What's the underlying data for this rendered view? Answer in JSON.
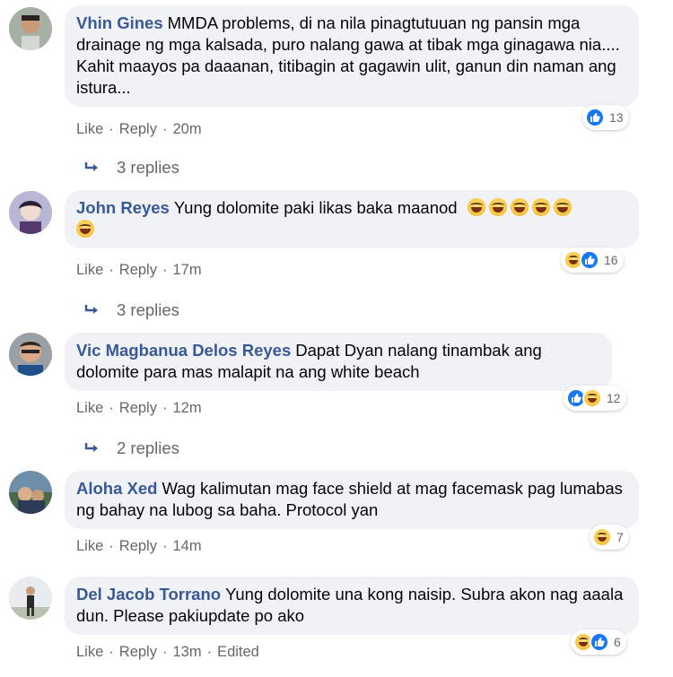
{
  "colors": {
    "author": "#385898",
    "bubble": "#f0f2f5",
    "meta": "#65676b",
    "like_blue": "#1877f2",
    "haha_yellow": "#f7c23a"
  },
  "actions": {
    "like": "Like",
    "reply": "Reply"
  },
  "comments": [
    {
      "author": "Vhin Gines",
      "text": "MMDA problems, di na nila pinagtutuuan ng pansin mga drainage ng mga kalsada, puro nalang gawa at tibak mga ginagawa nia.... Kahit maayos pa daaanan, titibagin at gagawin ulit, ganun din naman ang istura...",
      "time": "20m",
      "edited": "",
      "reactions": {
        "icons": [
          "like-icon"
        ],
        "count": "13"
      },
      "replies": "3 replies"
    },
    {
      "author": "John Reyes",
      "text": "Yung dolomite paki likas baka maanod",
      "emoji_count": 6,
      "time": "17m",
      "edited": "",
      "reactions": {
        "icons": [
          "haha-icon",
          "like-icon"
        ],
        "count": "16"
      },
      "replies": "3 replies"
    },
    {
      "author": "Vic Magbanua Delos Reyes",
      "text": "Dapat Dyan nalang tinambak ang dolomite para mas malapit na ang white beach",
      "time": "12m",
      "edited": "",
      "reactions": {
        "icons": [
          "like-icon",
          "haha-icon"
        ],
        "count": "12"
      },
      "replies": "2 replies"
    },
    {
      "author": "Aloha Xed",
      "text": "Wag kalimutan mag face shield at mag facemask pag lumabas ng bahay na lubog sa baha. Protocol yan",
      "time": "14m",
      "edited": "",
      "reactions": {
        "icons": [
          "haha-icon"
        ],
        "count": "7"
      },
      "replies": ""
    },
    {
      "author": "Del Jacob Torrano",
      "text": "Yung dolomite una kong naisip. Subra akon nag aaala dun. Please pakiupdate po ako",
      "time": "13m",
      "edited": "Edited",
      "reactions": {
        "icons": [
          "haha-icon",
          "like-icon"
        ],
        "count": "6"
      },
      "replies": ""
    }
  ]
}
